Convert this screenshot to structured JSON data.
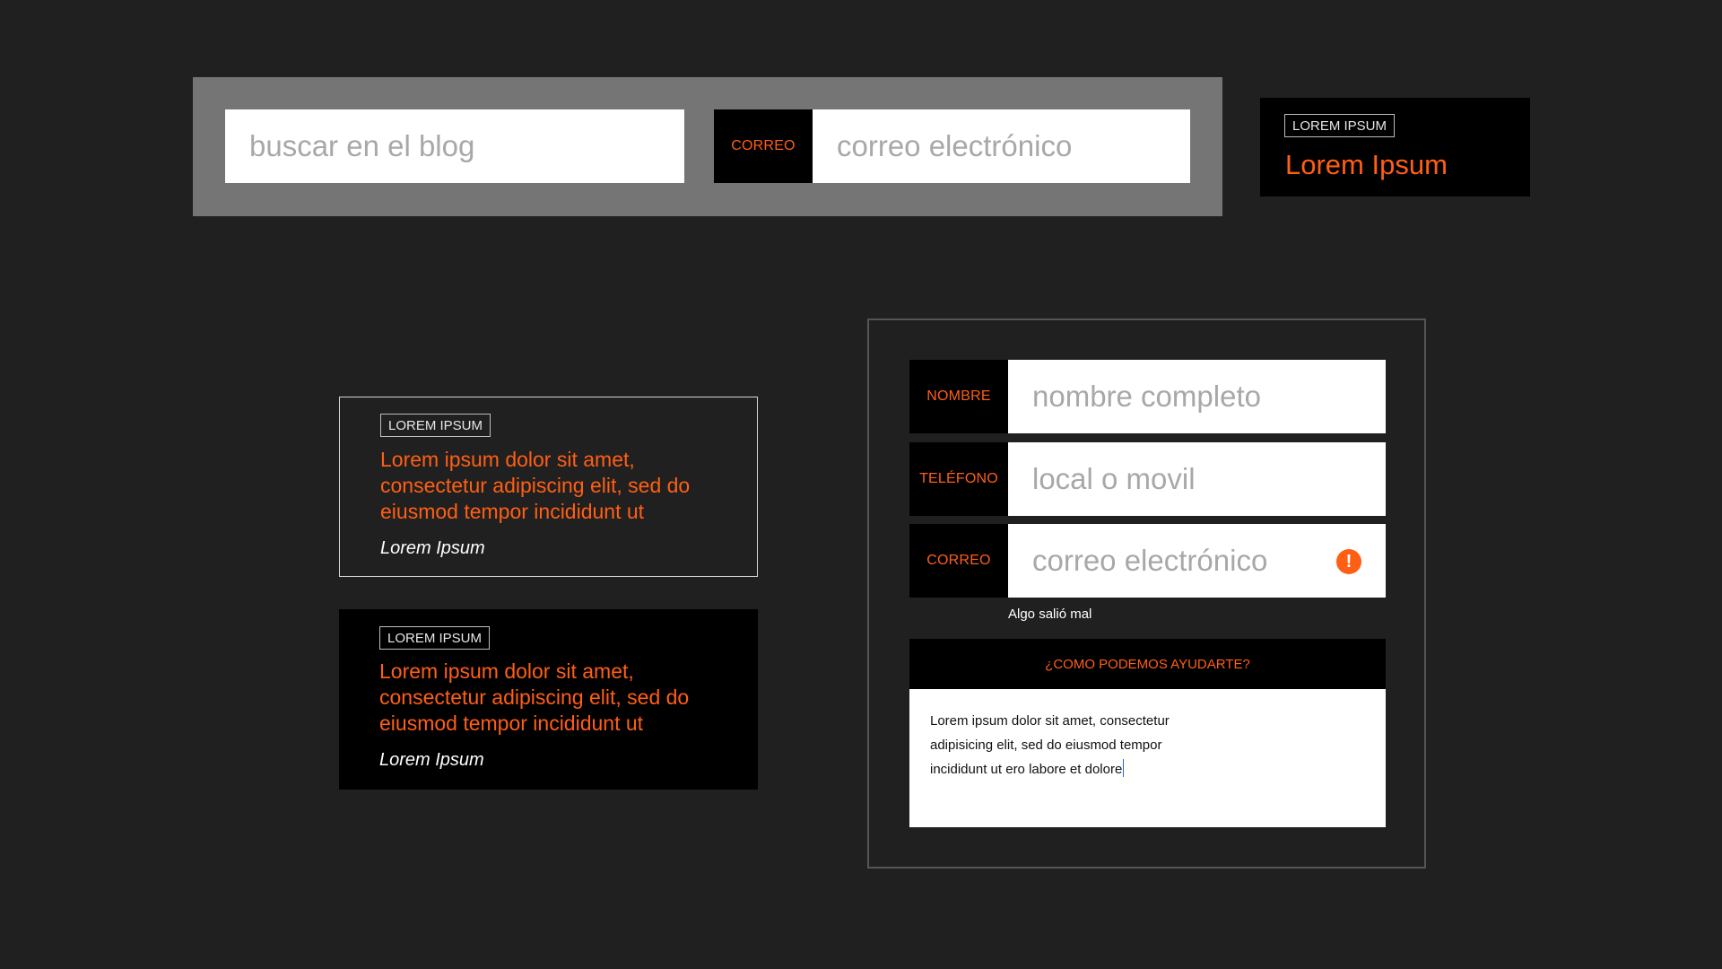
{
  "search_bar": {
    "blog_search_placeholder": "buscar en el blog",
    "email_label": "CORREO",
    "email_placeholder": "correo electrónico"
  },
  "mini_card": {
    "tag": "LOREM IPSUM",
    "title": "Lorem Ipsum"
  },
  "articles": [
    {
      "style": "outline",
      "tag": "LOREM IPSUM",
      "body": "Lorem ipsum dolor sit amet, consectetur adipiscing elit, sed do eiusmod tempor incididunt ut",
      "author": "Lorem Ipsum"
    },
    {
      "style": "solid",
      "tag": "LOREM IPSUM",
      "body": "Lorem ipsum dolor sit amet, consectetur adipiscing elit, sed do eiusmod tempor incididunt ut",
      "author": "Lorem Ipsum"
    }
  ],
  "contact_form": {
    "name_label": "NOMBRE",
    "name_placeholder": "nombre completo",
    "phone_label": "TELÉFONO",
    "phone_placeholder": "local o movil",
    "email_label": "CORREO",
    "email_placeholder": "correo electrónico",
    "email_error_icon": "alert-icon",
    "error_message": "Algo salió mal",
    "help_title": "¿COMO PODEMOS AYUDARTE?",
    "help_text": "Lorem ipsum dolor sit amet, consectetur adipisicing elit, sed do eiusmod tempor incididunt ut ero labore et dolore"
  },
  "colors": {
    "background": "#202020",
    "accent": "#ff5f14",
    "panel_gray": "#757575",
    "black": "#000000",
    "white": "#ffffff",
    "placeholder": "#a8a8a8"
  }
}
